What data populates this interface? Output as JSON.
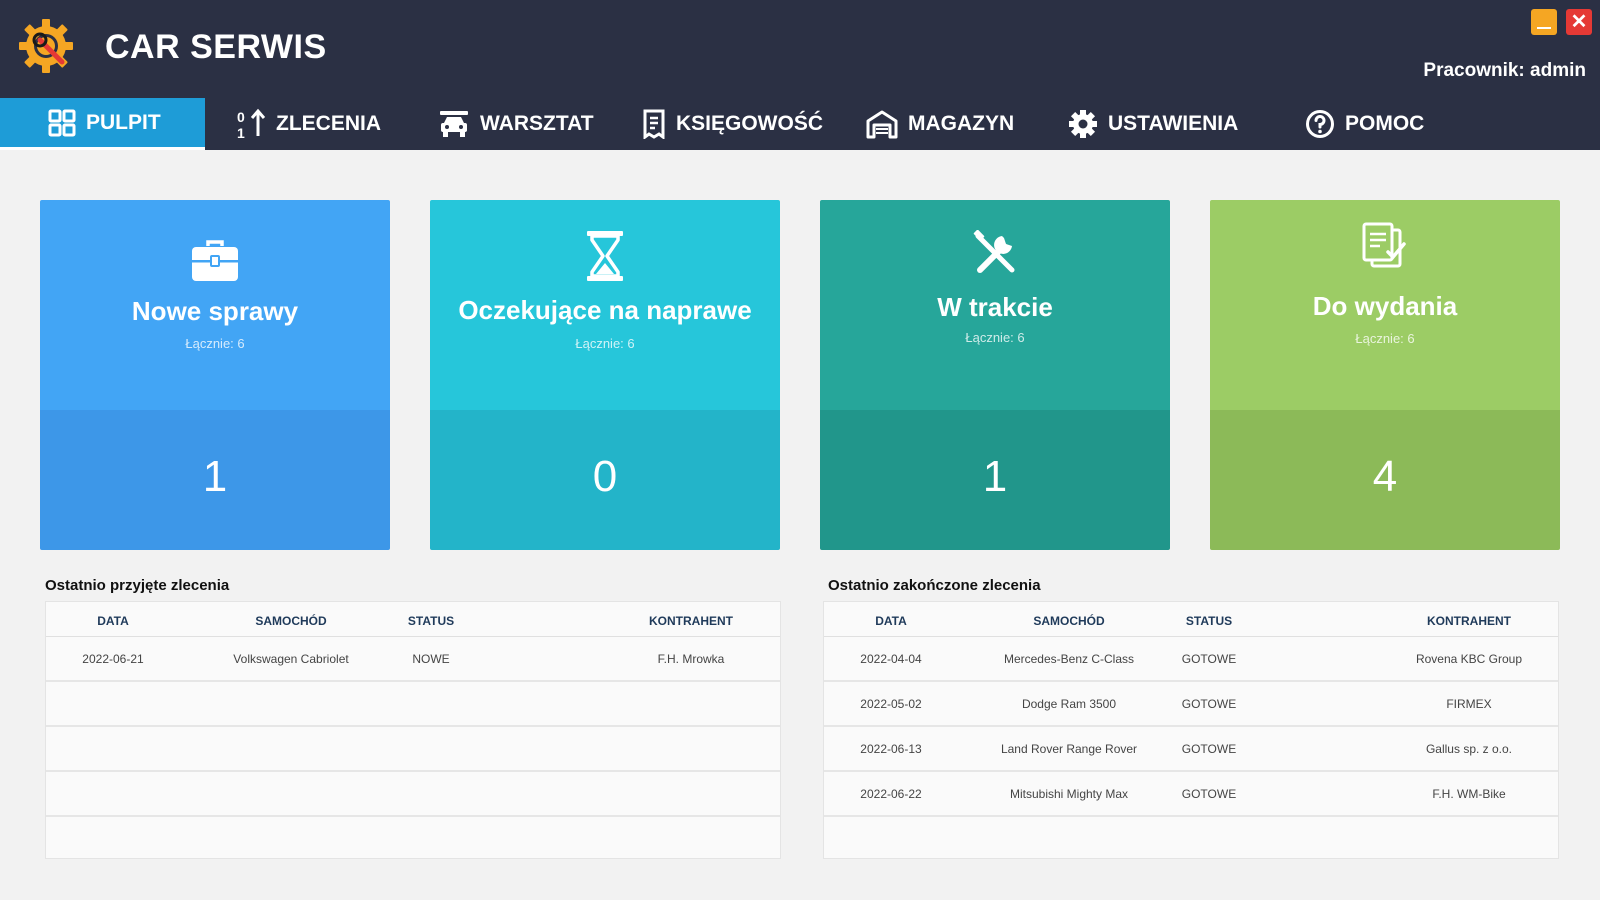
{
  "app": {
    "title": "CAR SERWIS",
    "user_label": "Pracownik: admin",
    "close_symbol": "✕"
  },
  "nav": [
    {
      "label": "PULPIT",
      "icon": "dashboard-grid-icon",
      "active": true
    },
    {
      "label": "ZLECENIA",
      "icon": "sort-numbers-icon"
    },
    {
      "label": "WARSZTAT",
      "icon": "car-service-icon"
    },
    {
      "label": "KSIĘGOWOŚĆ",
      "icon": "receipt-icon"
    },
    {
      "label": "MAGAZYN",
      "icon": "warehouse-icon"
    },
    {
      "label": "USTAWIENIA",
      "icon": "gear-icon"
    },
    {
      "label": "POMOC",
      "icon": "help-circle-icon"
    }
  ],
  "cards": [
    {
      "title": "Nowe sprawy",
      "subtitle": "Łącznie: 6",
      "count": "1",
      "icon": "briefcase-icon",
      "color_top": "#42a5f5",
      "color_bottom": "#3d97e8"
    },
    {
      "title": "Oczekujące na naprawe",
      "subtitle": "Łącznie: 6",
      "count": "0",
      "icon": "hourglass-icon",
      "color_top": "#26c6da",
      "color_bottom": "#23b4c9"
    },
    {
      "title": "W trakcie",
      "subtitle": "Łącznie: 6",
      "count": "1",
      "icon": "tools-icon",
      "color_top": "#26a69a",
      "color_bottom": "#21968b"
    },
    {
      "title": "Do wydania",
      "subtitle": "Łącznie: 6",
      "count": "4",
      "icon": "documents-check-icon",
      "color_top": "#9ccc65",
      "color_bottom": "#8cba58"
    }
  ],
  "recent_received": {
    "title": "Ostatnio przyjęte zlecenia",
    "columns": [
      "DATA",
      "SAMOCHÓD",
      "STATUS",
      "KONTRAHENT"
    ],
    "rows": [
      [
        "2022-06-21",
        "Volkswagen Cabriolet",
        "NOWE",
        "F.H. Mrowka"
      ]
    ]
  },
  "recent_completed": {
    "title": "Ostatnio zakończone zlecenia",
    "columns": [
      "DATA",
      "SAMOCHÓD",
      "STATUS",
      "KONTRAHENT"
    ],
    "rows": [
      [
        "2022-04-04",
        "Mercedes-Benz C-Class",
        "GOTOWE",
        "Rovena KBC Group"
      ],
      [
        "2022-05-02",
        "Dodge Ram 3500",
        "GOTOWE",
        "FIRMEX"
      ],
      [
        "2022-06-13",
        "Land Rover Range Rover",
        "GOTOWE",
        "Gallus sp. z o.o."
      ],
      [
        "2022-06-22",
        "Mitsubishi Mighty Max",
        "GOTOWE",
        "F.H. WM-Bike"
      ]
    ]
  }
}
